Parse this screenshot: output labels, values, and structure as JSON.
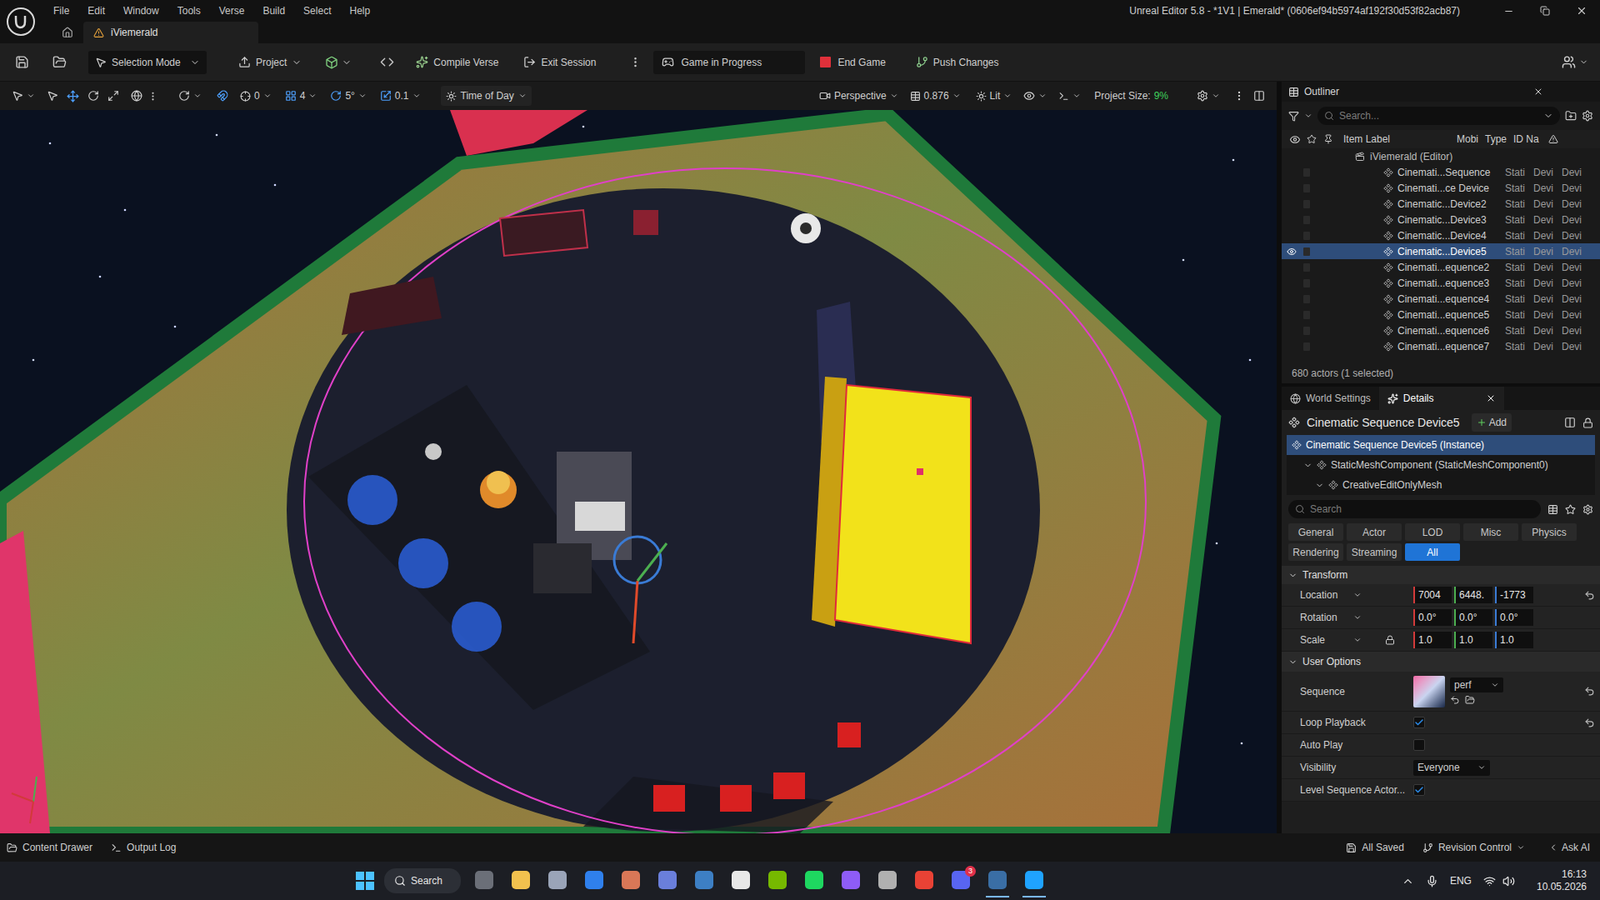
{
  "window": {
    "title": "Unreal Editor 5.8 - *1V1 | Emerald* (0606ef94b5974af192f30d53f82acb87)"
  },
  "menu": [
    "File",
    "Edit",
    "Window",
    "Tools",
    "Verse",
    "Build",
    "Select",
    "Help"
  ],
  "document_tab": {
    "label": "iViemerald",
    "warning": true
  },
  "toolbar": {
    "mode": "Selection Mode",
    "project": "Project",
    "compile": "Compile Verse",
    "exit": "Exit Session",
    "session_state": "Game in Progress",
    "end": "End Game",
    "push": "Push Changes"
  },
  "viewport_toolbar": {
    "snap_rotation": "0",
    "grid": "4",
    "snap_angle": "5°",
    "snap_scale": "0.1",
    "time_of_day": "Time of Day",
    "view": "Perspective",
    "camera_speed": "0.876",
    "view_mode": "Lit",
    "project_size_label": "Project Size:",
    "project_size_value": "9%"
  },
  "outliner": {
    "title": "Outliner",
    "search": {
      "placeholder": "Search..."
    },
    "columns": [
      "Item Label",
      "Mobi",
      "Type",
      "ID Na"
    ],
    "root": "iViemerald (Editor)",
    "rows": [
      {
        "label": "Cinemati...Sequence",
        "mobility": "Stati",
        "type": "Devi",
        "id": "Devi",
        "selected": false,
        "visible": false
      },
      {
        "label": "Cinemati...ce Device",
        "mobility": "Stati",
        "type": "Devi",
        "id": "Devi",
        "selected": false,
        "visible": false
      },
      {
        "label": "Cinematic...Device2",
        "mobility": "Stati",
        "type": "Devi",
        "id": "Devi",
        "selected": false,
        "visible": false
      },
      {
        "label": "Cinematic...Device3",
        "mobility": "Stati",
        "type": "Devi",
        "id": "Devi",
        "selected": false,
        "visible": false
      },
      {
        "label": "Cinematic...Device4",
        "mobility": "Stati",
        "type": "Devi",
        "id": "Devi",
        "selected": false,
        "visible": false
      },
      {
        "label": "Cinematic...Device5",
        "mobility": "Stati",
        "type": "Devi",
        "id": "Devi",
        "selected": true,
        "visible": true
      },
      {
        "label": "Cinemati...equence2",
        "mobility": "Stati",
        "type": "Devi",
        "id": "Devi",
        "selected": false,
        "visible": false
      },
      {
        "label": "Cinemati...equence3",
        "mobility": "Stati",
        "type": "Devi",
        "id": "Devi",
        "selected": false,
        "visible": false
      },
      {
        "label": "Cinemati...equence4",
        "mobility": "Stati",
        "type": "Devi",
        "id": "Devi",
        "selected": false,
        "visible": false
      },
      {
        "label": "Cinemati...equence5",
        "mobility": "Stati",
        "type": "Devi",
        "id": "Devi",
        "selected": false,
        "visible": false
      },
      {
        "label": "Cinemati...equence6",
        "mobility": "Stati",
        "type": "Devi",
        "id": "Devi",
        "selected": false,
        "visible": false
      },
      {
        "label": "Cinemati...equence7",
        "mobility": "Stati",
        "type": "Devi",
        "id": "Devi",
        "selected": false,
        "visible": false
      }
    ],
    "footer": "680 actors (1 selected)"
  },
  "details": {
    "tabs": [
      {
        "label": "World Settings",
        "selected": false
      },
      {
        "label": "Details",
        "selected": true
      }
    ],
    "actor": "Cinematic Sequence Device5",
    "add": "Add",
    "components": [
      {
        "label": "Cinematic Sequence Device5 (Instance)",
        "depth": 0,
        "selected": true,
        "expanded": false
      },
      {
        "label": "StaticMeshComponent (StaticMeshComponent0)",
        "depth": 1,
        "selected": false,
        "expanded": true
      },
      {
        "label": "CreativeEditOnlyMesh",
        "depth": 2,
        "selected": false,
        "expanded": true
      }
    ],
    "search": {
      "placeholder": "Search"
    },
    "filters": [
      {
        "label": "General",
        "selected": false
      },
      {
        "label": "Actor",
        "selected": false
      },
      {
        "label": "LOD",
        "selected": false
      },
      {
        "label": "Misc",
        "selected": false
      },
      {
        "label": "Physics",
        "selected": false
      },
      {
        "label": "Rendering",
        "selected": false
      },
      {
        "label": "Streaming",
        "selected": false
      },
      {
        "label": "All",
        "selected": true
      }
    ],
    "transform": {
      "title": "Transform",
      "rows": [
        {
          "label": "Location",
          "values": [
            "7004",
            "6448.",
            "-1773"
          ],
          "modified": true,
          "lock": false
        },
        {
          "label": "Rotation",
          "values": [
            "0.0°",
            "0.0°",
            "0.0°"
          ],
          "modified": false,
          "lock": false
        },
        {
          "label": "Scale",
          "values": [
            "1.0",
            "1.0",
            "1.0"
          ],
          "modified": false,
          "lock": true
        }
      ]
    },
    "user_options": {
      "title": "User Options",
      "rows": [
        {
          "kind": "asset",
          "label": "Sequence",
          "value": "perf",
          "modified": true
        },
        {
          "kind": "checkbox",
          "label": "Loop Playback",
          "checked": true,
          "modified": true
        },
        {
          "kind": "checkbox",
          "label": "Auto Play",
          "checked": false,
          "modified": false
        },
        {
          "kind": "dropdown",
          "label": "Visibility",
          "value": "Everyone",
          "modified": false
        },
        {
          "kind": "checkbox",
          "label": "Level Sequence Actor...",
          "checked": true,
          "modified": false
        }
      ]
    }
  },
  "status_bar": {
    "left": [
      "Content Drawer",
      "Output Log"
    ],
    "saved": "All Saved",
    "revision": "Revision Control",
    "ai": "Ask AI"
  },
  "taskbar": {
    "search": "Search",
    "language": "ENG",
    "time": "16:13",
    "date": "10.05.2026",
    "apps": [
      {
        "color": "#6b6f78",
        "active": false,
        "badge": ""
      },
      {
        "color": "#f2c14e",
        "active": false,
        "badge": ""
      },
      {
        "color": "#9aa4b8",
        "active": false,
        "badge": ""
      },
      {
        "color": "#2f80ed",
        "active": false,
        "badge": ""
      },
      {
        "color": "#d97757",
        "active": false,
        "badge": ""
      },
      {
        "color": "#6a7fdb",
        "active": false,
        "badge": ""
      },
      {
        "color": "#3d7fc4",
        "active": false,
        "badge": ""
      },
      {
        "color": "#e8e8e8",
        "active": false,
        "badge": ""
      },
      {
        "color": "#76b900",
        "active": false,
        "badge": ""
      },
      {
        "color": "#1ed760",
        "active": false,
        "badge": ""
      },
      {
        "color": "#8e5cf7",
        "active": false,
        "badge": ""
      },
      {
        "color": "#b0b0b0",
        "active": false,
        "badge": ""
      },
      {
        "color": "#e94235",
        "active": false,
        "badge": ""
      },
      {
        "color": "#5865f2",
        "active": false,
        "badge": "3"
      },
      {
        "color": "#3a6ea5",
        "active": true,
        "badge": ""
      },
      {
        "color": "#1fa3ff",
        "active": true,
        "badge": ""
      }
    ]
  }
}
